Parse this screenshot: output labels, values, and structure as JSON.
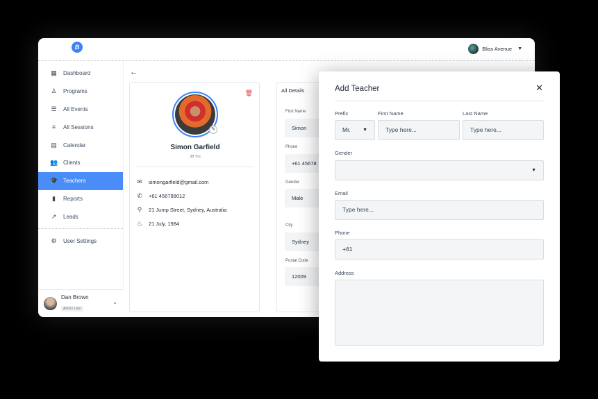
{
  "topbar": {
    "logo": "B",
    "account_name": "Bliss Avenue"
  },
  "sidebar": {
    "items": [
      {
        "label": "Dashboard",
        "icon": "dashboard-icon",
        "glyph": "▦"
      },
      {
        "label": "Programs",
        "icon": "person-icon",
        "glyph": "♙"
      },
      {
        "label": "All Events",
        "icon": "list-icon",
        "glyph": "☰"
      },
      {
        "label": "All Sessions",
        "icon": "lines-icon",
        "glyph": "≡"
      },
      {
        "label": "Calendar",
        "icon": "calendar-icon",
        "glyph": "▤"
      },
      {
        "label": "Clients",
        "icon": "group-icon",
        "glyph": "👥"
      },
      {
        "label": "Teachers",
        "icon": "graduation-cap-icon",
        "glyph": "🎓"
      },
      {
        "label": "Reports",
        "icon": "bar-chart-icon",
        "glyph": "▮"
      },
      {
        "label": "Leads",
        "icon": "trend-icon",
        "glyph": "↗"
      }
    ],
    "settings_items": [
      {
        "label": "User Settings",
        "icon": "user-settings-icon",
        "glyph": "⚙"
      }
    ],
    "active": "Teachers",
    "user": {
      "name": "Dan Brown",
      "role": "Admin User"
    }
  },
  "profile": {
    "name": "Simon Garfield",
    "age": "38 Yrs",
    "email": "simongarfield@gmail.com",
    "phone": "+61 456789012",
    "address": "21 Jump Street, Sydney, Australia",
    "birthday": "21 July, 1984"
  },
  "details": {
    "title": "All Details",
    "fields": [
      {
        "label": "First Name",
        "value": "Simon"
      },
      {
        "label": "Phone",
        "value": "+61 45678"
      },
      {
        "label": "Gender",
        "value": "Male"
      },
      {
        "label": "City",
        "value": "Sydney"
      },
      {
        "label": "Postal Code",
        "value": "12009"
      }
    ]
  },
  "modal": {
    "title": "Add Teacher",
    "prefix_label": "Prefix",
    "prefix_value": "Mr.",
    "first_name_label": "First Name",
    "first_name_placeholder": "Type here...",
    "last_name_label": "Last Name",
    "last_name_placeholder": "Type here...",
    "gender_label": "Gender",
    "gender_value": "",
    "email_label": "Email",
    "email_placeholder": "Type here...",
    "phone_label": "Phone",
    "phone_value": "+61",
    "address_label": "Address",
    "address_value": ""
  },
  "colors": {
    "accent": "#4a8df8",
    "danger": "#e53e3e"
  }
}
